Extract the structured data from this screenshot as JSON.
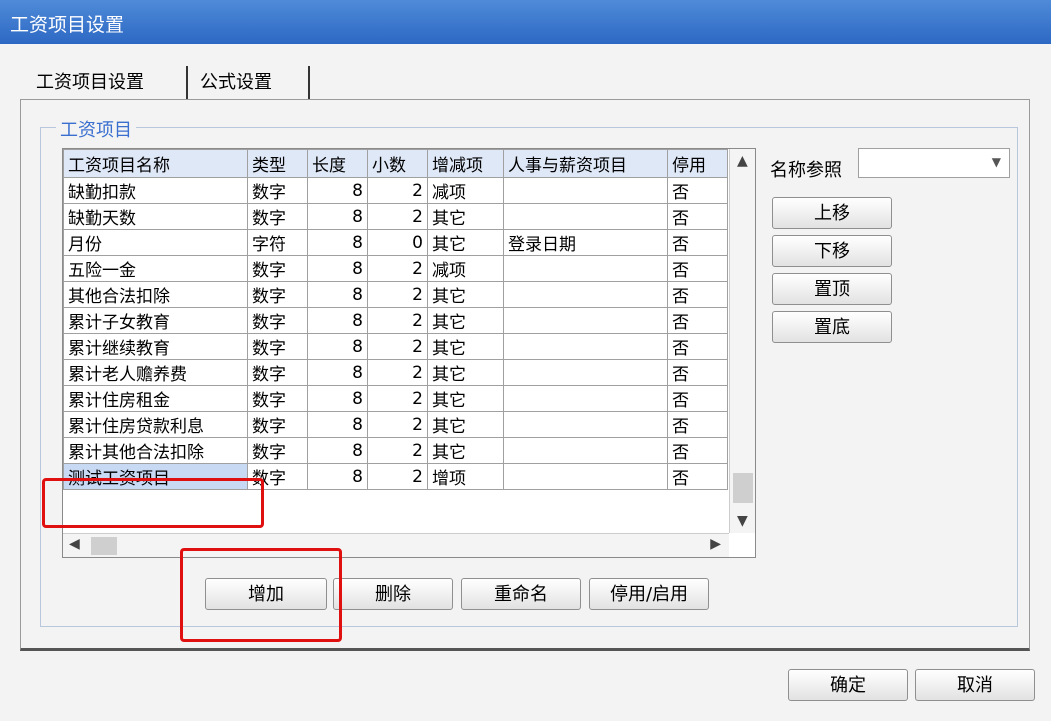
{
  "window": {
    "title": "工资项目设置"
  },
  "tabs": [
    {
      "label": "工资项目设置"
    },
    {
      "label": "公式设置"
    }
  ],
  "group": {
    "label": "工资项目"
  },
  "table": {
    "columns": [
      "工资项目名称",
      "类型",
      "长度",
      "小数",
      "增减项",
      "人事与薪资项目",
      "停用"
    ],
    "rows": [
      [
        "缺勤扣款",
        "数字",
        "8",
        "2",
        "减项",
        "",
        "否"
      ],
      [
        "缺勤天数",
        "数字",
        "8",
        "2",
        "其它",
        "",
        "否"
      ],
      [
        "月份",
        "字符",
        "8",
        "0",
        "其它",
        "登录日期",
        "否"
      ],
      [
        "五险一金",
        "数字",
        "8",
        "2",
        "减项",
        "",
        "否"
      ],
      [
        "其他合法扣除",
        "数字",
        "8",
        "2",
        "其它",
        "",
        "否"
      ],
      [
        "累计子女教育",
        "数字",
        "8",
        "2",
        "其它",
        "",
        "否"
      ],
      [
        "累计继续教育",
        "数字",
        "8",
        "2",
        "其它",
        "",
        "否"
      ],
      [
        "累计老人赡养费",
        "数字",
        "8",
        "2",
        "其它",
        "",
        "否"
      ],
      [
        "累计住房租金",
        "数字",
        "8",
        "2",
        "其它",
        "",
        "否"
      ],
      [
        "累计住房贷款利息",
        "数字",
        "8",
        "2",
        "其它",
        "",
        "否"
      ],
      [
        "累计其他合法扣除",
        "数字",
        "8",
        "2",
        "其它",
        "",
        "否"
      ],
      [
        "测试工资项目",
        "数字",
        "8",
        "2",
        "增项",
        "",
        "否"
      ]
    ]
  },
  "side": {
    "name_ref_label": "名称参照",
    "combo_value": "",
    "move_up": "上移",
    "move_down": "下移",
    "to_top": "置顶",
    "to_bottom": "置底"
  },
  "actions": {
    "add": "增加",
    "delete": "删除",
    "rename": "重命名",
    "toggle": "停用/启用"
  },
  "dialog": {
    "ok": "确定",
    "cancel": "取消"
  },
  "colors": {
    "titlebar": "#2d68c4",
    "highlight": "#e01010",
    "selected_cell": "#c8d9f4"
  }
}
